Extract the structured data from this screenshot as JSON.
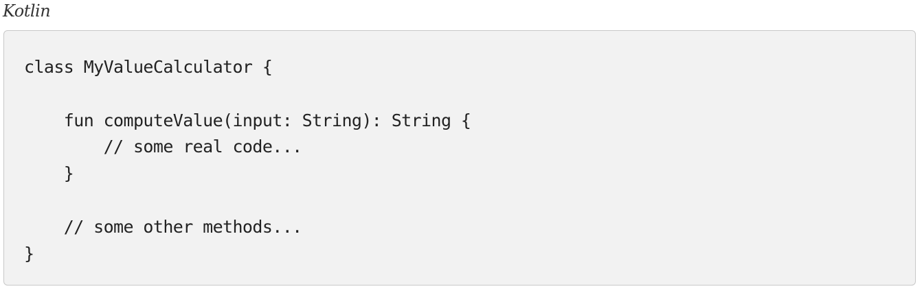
{
  "listing": {
    "title": "Kotlin",
    "code_lines": [
      "class MyValueCalculator {",
      "",
      "    fun computeValue(input: String): String {",
      "        // some real code...",
      "    }",
      "",
      "    // some other methods...",
      "}"
    ]
  },
  "colors": {
    "panel_background": "#f2f2f2",
    "panel_border": "#c8c8c8",
    "code_text": "#222222",
    "title_text": "#333333"
  }
}
